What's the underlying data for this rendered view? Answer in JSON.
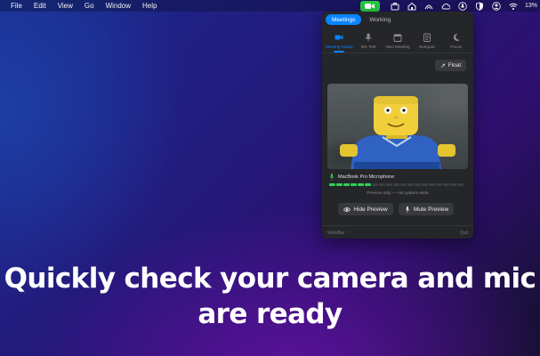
{
  "menubar": {
    "items": [
      "File",
      "Edit",
      "View",
      "Go",
      "Window",
      "Help"
    ],
    "icons": [
      "video-camera-icon",
      "briefcase-icon",
      "home-icon",
      "arc-icon",
      "cloud-icon",
      "microphone-icon",
      "shield-icon",
      "user-icon",
      "wifi-icon"
    ],
    "battery": "13%",
    "active_color": "#28c840"
  },
  "panel": {
    "segments": [
      {
        "label": "Meetings",
        "active": true
      },
      {
        "label": "Working",
        "active": false
      }
    ],
    "tabs": [
      {
        "label": "Meeting Ready",
        "icon": "video-camera-icon",
        "active": true
      },
      {
        "label": "Mic Test",
        "icon": "microphone-icon",
        "active": false
      },
      {
        "label": "Next Meeting",
        "icon": "calendar-icon",
        "active": false
      },
      {
        "label": "Notepad",
        "icon": "notepad-icon",
        "active": false
      },
      {
        "label": "Focus",
        "icon": "moon-icon",
        "active": false
      }
    ],
    "float_label": "Float",
    "microphone_name": "MacBook Pro Microphone",
    "mic_level": 0.33,
    "caption": "Preview only — not system-wide",
    "hide_preview_label": "Hide Preview",
    "mute_preview_label": "Mute Preview",
    "footer_left": "WorkBar",
    "footer_right": "Quit",
    "accent_color": "#0a84ff"
  },
  "headline": {
    "line1": "Quickly check your camera and mic",
    "line2": "are ready"
  }
}
